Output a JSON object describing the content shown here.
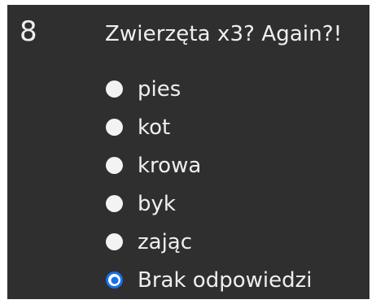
{
  "question": {
    "number": "8",
    "title": "Zwierzęta x3? Again?!",
    "options": [
      {
        "label": "pies",
        "selected": false
      },
      {
        "label": "kot",
        "selected": false
      },
      {
        "label": "krowa",
        "selected": false
      },
      {
        "label": "byk",
        "selected": false
      },
      {
        "label": "zając",
        "selected": false
      },
      {
        "label": "Brak odpowiedzi",
        "selected": true
      }
    ]
  },
  "colors": {
    "panel_background": "#2f2f2f",
    "text": "#efefef",
    "radio_fill": "#f3f3f3",
    "radio_selected_accent": "#1971e6"
  }
}
